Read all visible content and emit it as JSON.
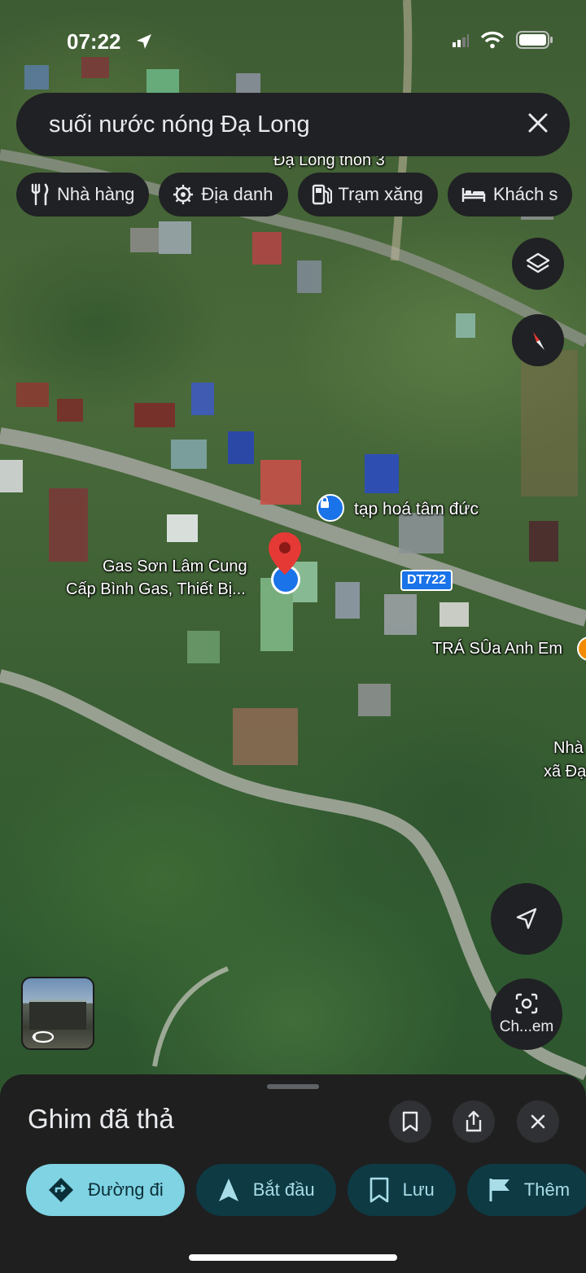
{
  "status_bar": {
    "time": "07:22"
  },
  "search": {
    "query": "suối nước nóng Đạ Long"
  },
  "chips": [
    {
      "label": "Nhà hàng",
      "icon": "fork-knife-icon"
    },
    {
      "label": "Địa danh",
      "icon": "landmark-icon"
    },
    {
      "label": "Trạm xăng",
      "icon": "gas-pump-icon"
    },
    {
      "label": "Khách s",
      "icon": "bed-icon"
    }
  ],
  "map": {
    "labels": {
      "village": "Đạ Long thôn 3",
      "store": "tạp hoá tâm đức",
      "gas_line1": "Gas Sơn Lâm Cung",
      "gas_line2": "Cấp Bình Gas, Thiết Bị...",
      "road_tag": "DT722",
      "milktea": "TRÁ SÛa Anh Em",
      "right_line1": "Nhà",
      "right_line2": "xã Đạ"
    },
    "camera_label": "Ch...em",
    "colors": {
      "pin": "#e53935",
      "poi_blue": "#1a73e8",
      "poi_orange": "#f28b00"
    }
  },
  "sheet": {
    "title": "Ghim đã thả",
    "actions": [
      {
        "label": "Đường đi",
        "icon": "directions-icon"
      },
      {
        "label": "Bắt đầu",
        "icon": "navigation-arrow-icon"
      },
      {
        "label": "Lưu",
        "icon": "bookmark-icon"
      },
      {
        "label": "Thêm",
        "icon": "flag-icon"
      }
    ]
  }
}
